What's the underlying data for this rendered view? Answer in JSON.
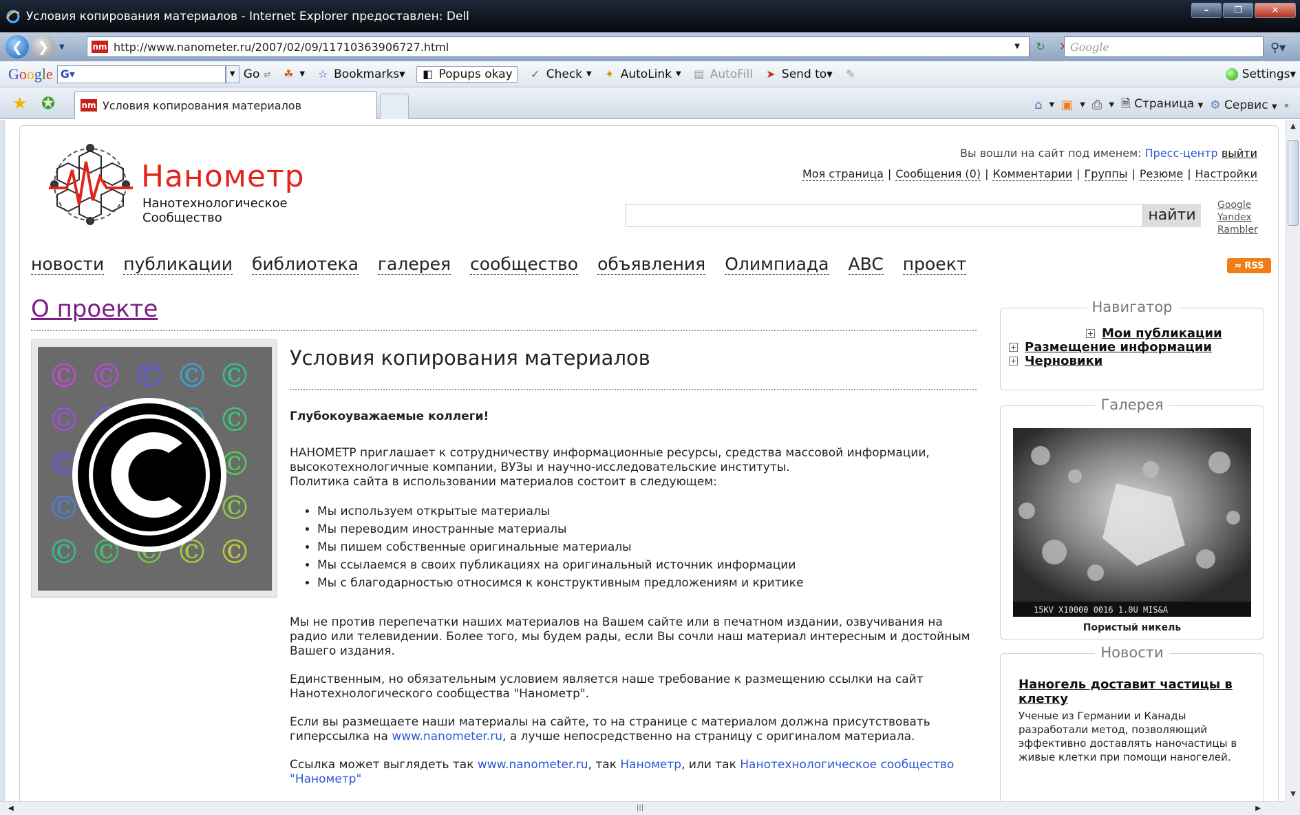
{
  "window": {
    "title": "Условия копирования материалов - Internet Explorer предоставлен: Dell"
  },
  "address_bar": {
    "url": "http://www.nanometer.ru/2007/02/09/11710363906727.html",
    "search_placeholder": "Google"
  },
  "google_toolbar": {
    "logo": "Google",
    "search_value": "G▾",
    "go": "Go",
    "bookmarks": "Bookmarks▾",
    "popups": "Popups okay",
    "check": "Check",
    "autolink": "AutoLink",
    "autofill": "AutoFill",
    "sendto": "Send to▾",
    "settings": "Settings▾"
  },
  "tab": {
    "favicon": "nm",
    "title": "Условия копирования материалов"
  },
  "command_bar": {
    "page": "Страница",
    "tools": "Сервис"
  },
  "site": {
    "logo_title": "Нанометр",
    "logo_sub_1": "Нанотехнологическое",
    "logo_sub_2": "Сообщество",
    "login_prefix": "Вы вошли на сайт под именем:",
    "login_user": "Пресс-центр",
    "logout": "выйти",
    "top_links": [
      "Моя страница",
      "Сообщения (0)",
      "Комментарии",
      "Группы",
      "Резюме",
      "Настройки"
    ],
    "search_button": "найти",
    "engines": [
      "Google",
      "Yandex",
      "Rambler"
    ],
    "nav": [
      "новости",
      "публикации",
      "библиотека",
      "галерея",
      "сообщество",
      "объявления",
      "Олимпиада",
      "ABC",
      "проект"
    ],
    "rss": "RSS"
  },
  "main": {
    "section_title": "О проекте",
    "article_title": "Условия копирования материалов",
    "greeting": "Глубокоуважаемые коллеги!",
    "intro_1": "НАНОМЕТР приглашает к сотрудничеству информационные ресурсы, средства массовой информации, высокотехнологичные компании, ВУЗы и научно-исследовательские институты.",
    "intro_2": "Политика сайта в использовании материалов состоит в следующем:",
    "bullets": [
      "Мы используем открытые материалы",
      "Мы переводим иностранные материалы",
      "Мы пишем собственные оригинальные материалы",
      "Мы ссылаемся в своих публикациях на оригинальный источник информации",
      "Мы с благодарностью относимся к конструктивным предложениям и критике"
    ],
    "para_1": "Мы не против перепечатки наших материалов на Вашем сайте или в печатном издании, озвучивания на радио или телевидении. Более того, мы будем рады, если Вы сочли наш материал интересным и достойным Вашего издания.",
    "para_2": "Единственным, но обязательным условием является наше требование к размещению ссылки на сайт Нанотехнологического сообщества \"Нанометр\".",
    "para_3_before": "Если вы размещаете наши материалы на сайте, то на странице с материалом должна присутствовать гиперссылка на",
    "para_3_link": "www.nanometer.ru",
    "para_3_after": ", а лучше непосредственно на страницу с оригиналом материала.",
    "para_4_before": "Ссылка может выглядеть так",
    "para_4_link1": "www.nanometer.ru",
    "para_4_mid1": ", так",
    "para_4_link2": "Нанометр",
    "para_4_mid2": ", или так",
    "para_4_link3": "Нанотехнологическое сообщество \"Нанометр\""
  },
  "sidebar": {
    "navigator_title": "Навигатор",
    "navigator_items": [
      "Мои публикации",
      "Размещение информации",
      "Черновики"
    ],
    "gallery_title": "Галерея",
    "gallery_caption": "Пористый никель",
    "sem_label": "15KV X10000  0016    1.0U MIS&A",
    "news_title": "Новости",
    "news_headline": "Наногель доставит частицы в клетку",
    "news_text": "Ученые из Германии и Канады разработали метод, позволяющий эффективно доставлять наночастицы в живые клетки при помощи наногелей."
  },
  "colors": {
    "logo_red": "#e3241a",
    "link_blue": "#2b57d4",
    "visited_purple": "#7a1f86",
    "rss_orange": "#f07d16"
  }
}
